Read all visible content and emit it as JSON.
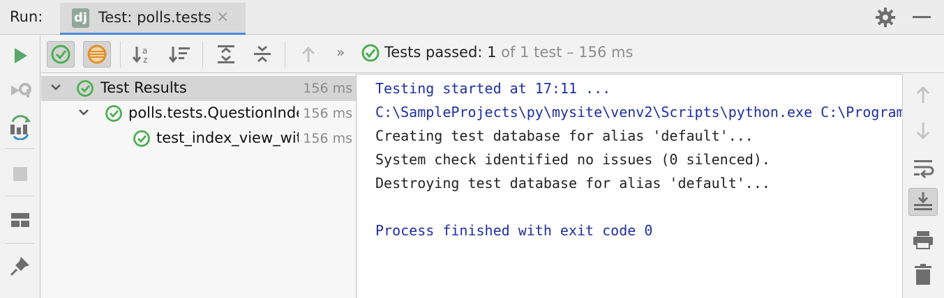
{
  "titlebar": {
    "run_label": "Run:",
    "tab_title": "Test: polls.tests",
    "tab_logo_text": "dj",
    "close_glyph": "×"
  },
  "status": {
    "passed_label": "Tests passed:",
    "passed_count": "1",
    "of_total": "of 1 test – 156 ms"
  },
  "toolbar_overflow": "»",
  "tree": {
    "rows": [
      {
        "label": "Test Results",
        "time": "156 ms"
      },
      {
        "label": "polls.tests.QuestionIndexViewTests",
        "time": "156 ms"
      },
      {
        "label": "test_index_view_with_no_questions",
        "time": "156 ms"
      }
    ]
  },
  "console": {
    "lines": [
      "Testing started at 17:11 ...",
      "C:\\SampleProjects\\py\\mysite\\venv2\\Scripts\\python.exe C:\\Program Files\\JetBrains",
      "Creating test database for alias 'default'...",
      "System check identified no issues (0 silenced).",
      "Destroying test database for alias 'default'...",
      "",
      "Process finished with exit code 0"
    ]
  },
  "colors": {
    "pass_green": "#4caf50",
    "run_green": "#59a869",
    "console_blue": "#1f2fa0"
  },
  "icons": {
    "left": [
      "run-icon",
      "rerun-failed-icon",
      "toggle-auto-test-icon",
      "stop-icon",
      "layout-icon",
      "pin-icon"
    ],
    "top": [
      "show-passed-icon",
      "show-ignored-icon",
      "sort-alphabetically-icon",
      "sort-by-duration-icon",
      "expand-all-icon",
      "collapse-all-icon",
      "previous-failed-icon"
    ],
    "right": [
      "up-arrow-icon",
      "down-arrow-icon",
      "soft-wrap-icon",
      "scroll-to-end-icon",
      "print-icon",
      "trash-icon"
    ]
  }
}
